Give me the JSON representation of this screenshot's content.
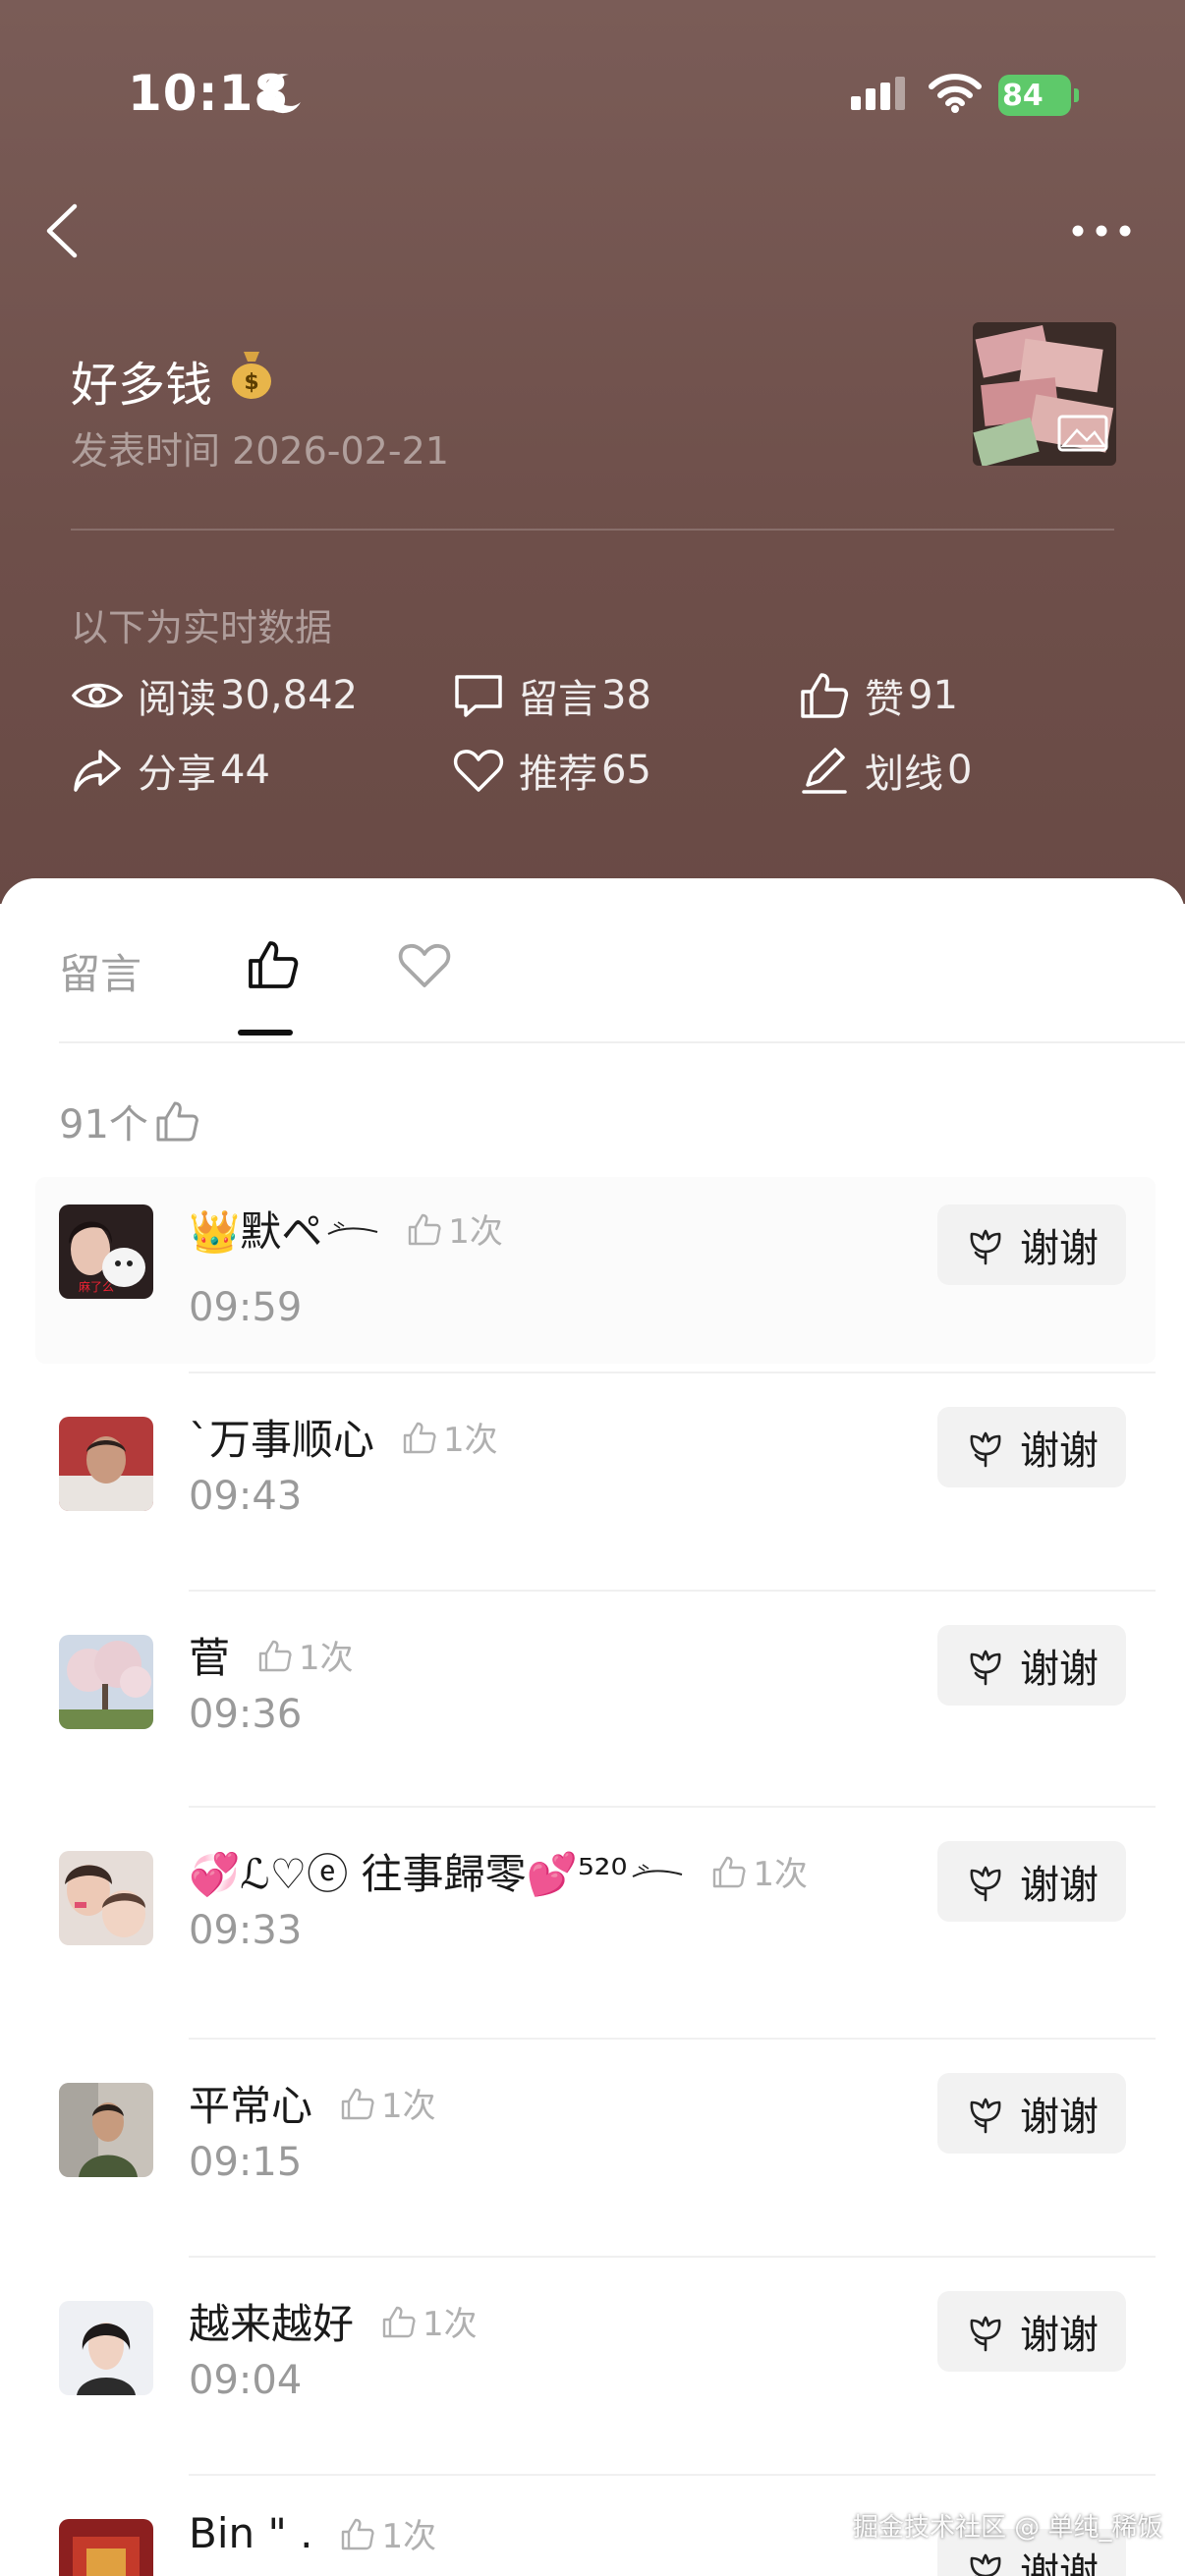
{
  "status": {
    "time": "10:18",
    "battery": "84"
  },
  "article": {
    "title": "好多钱",
    "publish_time": "发表时间 2026-02-21"
  },
  "realtime_label": "以下为实时数据",
  "stats": {
    "reads": {
      "label": "阅读",
      "value": "30,842"
    },
    "comments": {
      "label": "留言",
      "value": "38"
    },
    "likes": {
      "label": "赞",
      "value": "91"
    },
    "shares": {
      "label": "分享",
      "value": "44"
    },
    "recommends": {
      "label": "推荐",
      "value": "65"
    },
    "underlines": {
      "label": "划线",
      "value": "0"
    }
  },
  "tabs": {
    "comments_label": "留言"
  },
  "likes_total": "91个",
  "thanks_label": "谢谢",
  "likers": [
    {
      "name": "👑默ペ",
      "count": "1次",
      "time": "09:59"
    },
    {
      "name": "`万事顺心",
      "count": "1次",
      "time": "09:43"
    },
    {
      "name": "菅",
      "count": "1次",
      "time": "09:36"
    },
    {
      "name": "💞ℒ♡ⓔ 往事歸零💕⁵²⁰",
      "count": "1次",
      "time": "09:33"
    },
    {
      "name": "平常心",
      "count": "1次",
      "time": "09:15"
    },
    {
      "name": "越来越好",
      "count": "1次",
      "time": "09:04"
    },
    {
      "name": "Bin \" .",
      "count": "1次",
      "time": ""
    }
  ],
  "watermark": "掘金技术社区 @ 单纯_稀饭",
  "colors": {
    "header_bg": "#6e4f4a",
    "battery": "#5ec96a",
    "button_bg": "#f2f2f2"
  }
}
